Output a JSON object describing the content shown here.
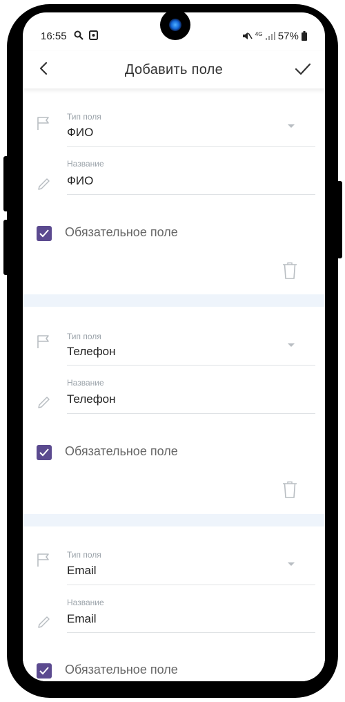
{
  "status_bar": {
    "time": "16:55",
    "left_icons": [
      "search-icon",
      "screenshot-icon"
    ],
    "network": "4G",
    "battery": "57%"
  },
  "header": {
    "title": "Добавить поле",
    "back_icon": "back-arrow-icon",
    "confirm_icon": "checkmark-icon"
  },
  "fields": [
    {
      "type_label": "Тип поля",
      "type_value": "ФИО",
      "name_label": "Название",
      "name_value": "ФИО",
      "required_label": "Обязательное поле",
      "required": true
    },
    {
      "type_label": "Тип поля",
      "type_value": "Телефон",
      "name_label": "Название",
      "name_value": "Телефон",
      "required_label": "Обязательное поле",
      "required": true
    },
    {
      "type_label": "Тип поля",
      "type_value": "Email",
      "name_label": "Название",
      "name_value": "Email",
      "required_label": "Обязательное поле",
      "required": true
    }
  ],
  "colors": {
    "accent": "#5b4a8f",
    "separator": "#eef4fb",
    "text": "#222222",
    "label": "#9aa2a9"
  }
}
